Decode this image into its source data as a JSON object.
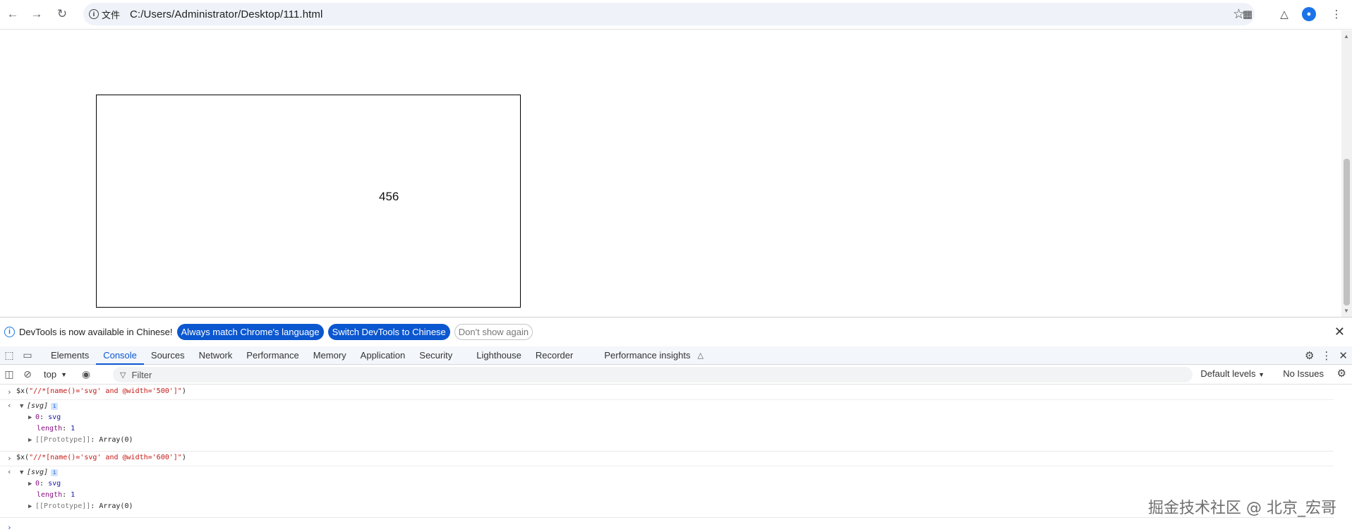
{
  "browser": {
    "back_icon": "arrow-left-icon",
    "forward_icon": "arrow-right-icon",
    "reload_icon": "reload-icon",
    "file_chip": "文件",
    "url": "C:/Users/Administrator/Desktop/111.html",
    "star_icon": "star-icon",
    "extension_icon": "extension-icon",
    "labs_icon": "flask-icon",
    "profile_icon": "profile-icon"
  },
  "page": {
    "svg_text": "456"
  },
  "infobar": {
    "message": "DevTools is now available in Chinese!",
    "btn_match": "Always match Chrome's language",
    "btn_switch": "Switch DevTools to Chinese",
    "btn_dont": "Don't show again"
  },
  "devtools": {
    "tabs": [
      "Elements",
      "Console",
      "Sources",
      "Network",
      "Performance",
      "Memory",
      "Application",
      "Security",
      "Lighthouse",
      "Recorder",
      "Performance insights"
    ],
    "active_tab": "Console",
    "context": "top",
    "filter_placeholder": "Filter",
    "levels": "Default levels",
    "issues": "No Issues"
  },
  "console": {
    "entries": [
      {
        "command_pre": "$x(",
        "command_str": "\"//*[name()='svg' and @width='500']\"",
        "command_post": ")",
        "result_label": "[svg]",
        "item_key": "0",
        "item_val": "svg",
        "length_key": "length",
        "length_val": "1",
        "proto_key": "[[Prototype]]",
        "proto_val": "Array(0)"
      },
      {
        "command_pre": "$x(",
        "command_str": "\"//*[name()='svg' and @width='600']\"",
        "command_post": ")",
        "result_label": "[svg]",
        "item_key": "0",
        "item_val": "svg",
        "length_key": "length",
        "length_val": "1",
        "proto_key": "[[Prototype]]",
        "proto_val": "Array(0)"
      }
    ]
  },
  "watermark": "掘金技术社区 @ 北京_宏哥"
}
